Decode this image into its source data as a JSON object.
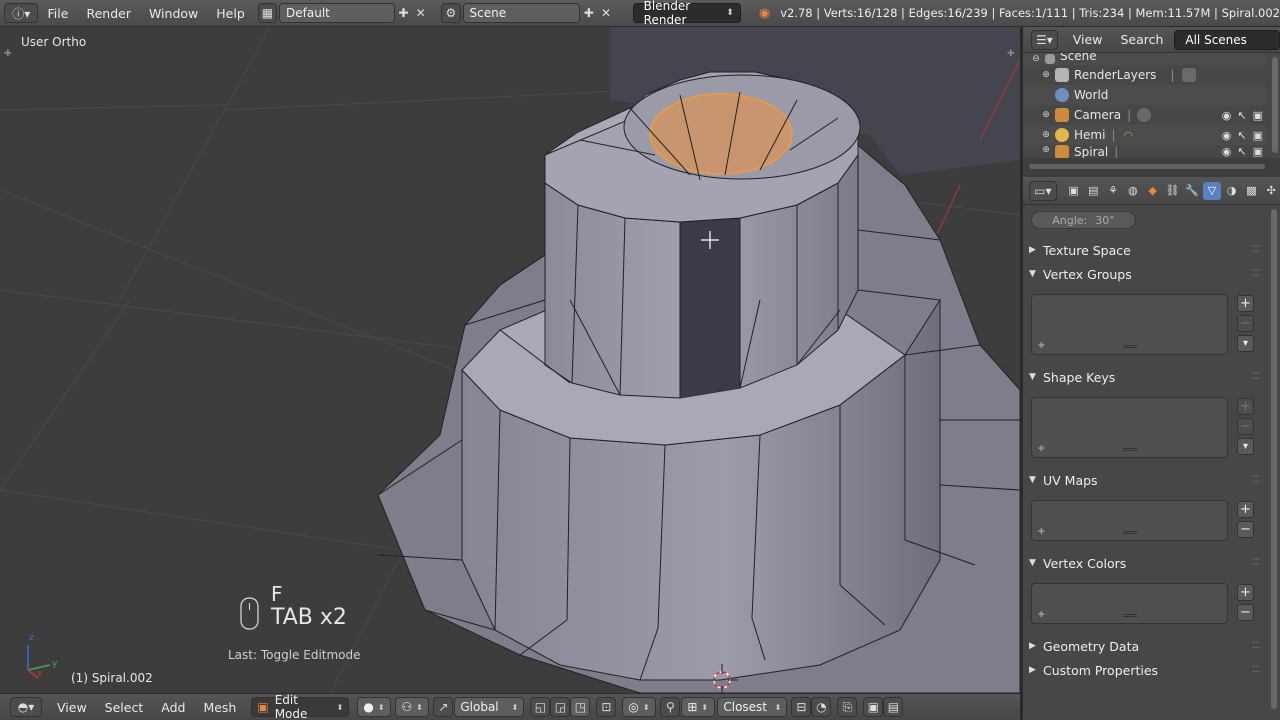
{
  "top_header": {
    "menus": [
      "File",
      "Render",
      "Window",
      "Help"
    ],
    "layout": "Default",
    "scene": "Scene",
    "engine": "Blender Render",
    "stats": "v2.78 | Verts:16/128 | Edges:16/239 | Faces:1/111 | Tris:234 | Mem:11.57M | Spiral.002"
  },
  "viewport": {
    "view_label": "User Ortho",
    "key_primary": "F",
    "key_secondary": "TAB x2",
    "last_operator": "Last: Toggle Editmode",
    "object_label": "(1) Spiral.002",
    "axis_z": "z",
    "axis_y": "y",
    "axis_x": "x"
  },
  "bottom_header": {
    "menus": [
      "View",
      "Select",
      "Add",
      "Mesh"
    ],
    "mode": "Edit Mode",
    "orientation": "Global",
    "snap_target": "Closest"
  },
  "outliner": {
    "menus": [
      "View",
      "Search"
    ],
    "filter": "All Scenes",
    "rows": [
      {
        "label": "Scene",
        "icon_color": "#9a9a9a"
      },
      {
        "label": "RenderLayers",
        "icon_color": "#b5b5b5"
      },
      {
        "label": "World",
        "icon_color": "#6f8fbf"
      },
      {
        "label": "Camera",
        "icon_color": "#d08b3a"
      },
      {
        "label": "Hemi",
        "icon_color": "#e0b84a"
      },
      {
        "label": "Spiral",
        "icon_color": "#d08b3a"
      }
    ]
  },
  "properties": {
    "angle_label": "Angle:",
    "angle_value": "30°",
    "panels": {
      "texture_space": "Texture Space",
      "vertex_groups": "Vertex Groups",
      "shape_keys": "Shape Keys",
      "uv_maps": "UV Maps",
      "vertex_colors": "Vertex Colors",
      "geometry_data": "Geometry Data",
      "custom_properties": "Custom Properties"
    }
  },
  "colors": {
    "selection": "#f29b38",
    "mesh_face": "#9595a5",
    "accent_blue": "#5680c2"
  }
}
